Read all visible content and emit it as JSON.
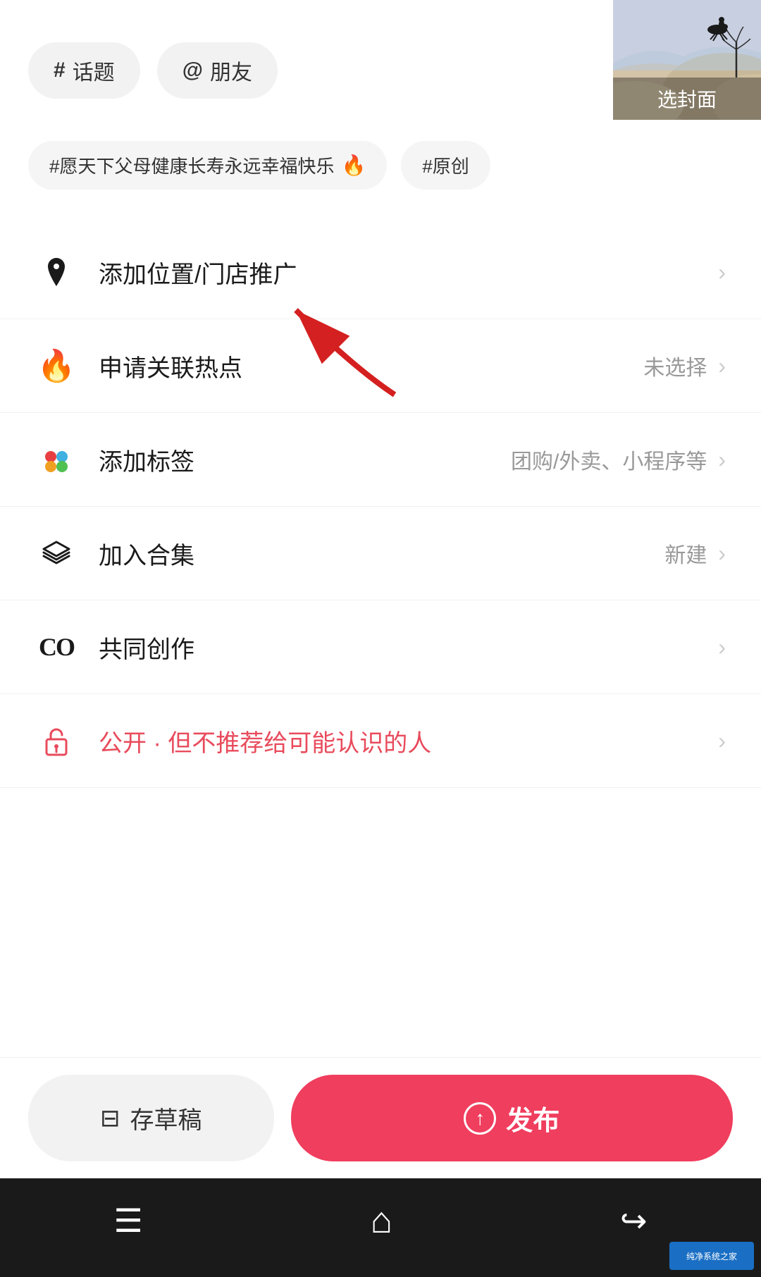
{
  "cover": {
    "label": "选封面"
  },
  "tags": {
    "topic": {
      "icon": "#",
      "label": "话题"
    },
    "friend": {
      "icon": "@",
      "label": "朋友"
    }
  },
  "hashtags": [
    {
      "text": "#愿天下父母健康长寿永远幸福快乐",
      "has_fire": true
    },
    {
      "text": "#原创",
      "has_fire": false
    }
  ],
  "menu_items": [
    {
      "id": "location",
      "icon_type": "location",
      "label": "添加位置/门店推广",
      "value": "",
      "has_arrow": true,
      "is_privacy": false
    },
    {
      "id": "hotspot",
      "icon_type": "fire",
      "label": "申请关联热点",
      "value": "未选择",
      "has_arrow": true,
      "is_privacy": false
    },
    {
      "id": "tags",
      "icon_type": "dots",
      "label": "添加标签",
      "value": "团购/外卖、小程序等",
      "has_arrow": true,
      "is_privacy": false
    },
    {
      "id": "collection",
      "icon_type": "layers",
      "label": "加入合集",
      "value": "新建",
      "has_arrow": true,
      "is_privacy": false
    },
    {
      "id": "collab",
      "icon_type": "co",
      "label": "共同创作",
      "value": "",
      "has_arrow": true,
      "is_privacy": false
    },
    {
      "id": "privacy",
      "icon_type": "lock",
      "label": "公开 · 但不推荐给可能认识的人",
      "value": "",
      "has_arrow": true,
      "is_privacy": true
    }
  ],
  "bottom_bar": {
    "draft_label": "存草稿",
    "publish_label": "发布"
  },
  "nav": {
    "menu_icon": "☰",
    "home_icon": "⌂",
    "back_icon": "↩"
  }
}
